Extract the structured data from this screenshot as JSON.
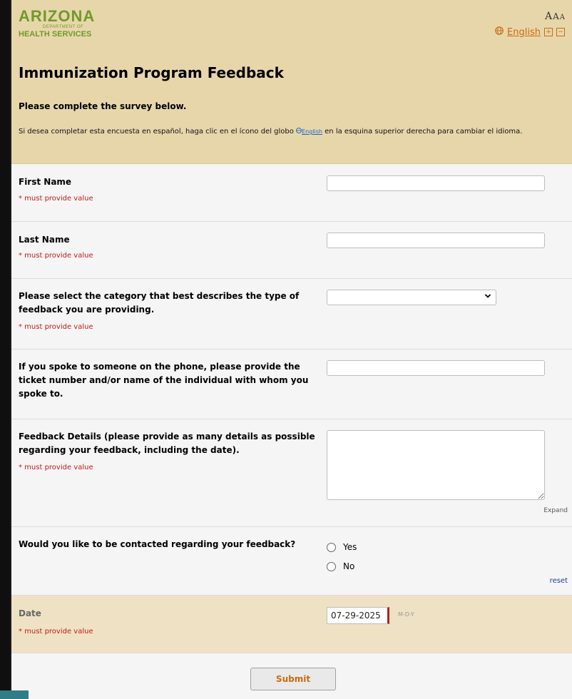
{
  "header": {
    "logo_line1": "ARIZONA",
    "logo_line2": "DEPARTMENT OF",
    "logo_line3": "HEALTH SERVICES",
    "font_size_controls": [
      "A",
      "A",
      "A"
    ],
    "language": "English",
    "plus": "+",
    "minus": "−",
    "title": "Immunization Program Feedback",
    "instructions": "Please complete the survey below.",
    "spanish_prefix": "Si desea completar esta encuesta en español, haga clic en el ícono del globo",
    "spanish_link": "English",
    "spanish_suffix": "en la esquina superior derecha para cambiar el idioma."
  },
  "form": {
    "required_text": "* must provide value",
    "first_name": {
      "label": "First Name",
      "value": ""
    },
    "last_name": {
      "label": "Last Name",
      "value": ""
    },
    "category": {
      "label": "Please select the category that best describes the type of feedback you are providing.",
      "value": ""
    },
    "ticket": {
      "label": "If you spoke to someone on the phone, please provide the ticket number and/or name of the individual with whom you spoke to.",
      "value": ""
    },
    "details": {
      "label": "Feedback Details (please provide as many details as possible regarding your feedback, including the date).",
      "value": "",
      "expand": "Expand"
    },
    "contact": {
      "label": "Would you like to be contacted regarding your feedback?",
      "options": [
        "Yes",
        "No"
      ],
      "reset": "reset"
    },
    "date": {
      "label": "Date",
      "value": "07-29-2025",
      "format": "M-D-Y"
    },
    "submit": "Submit"
  },
  "colors": {
    "header_bg": "#e8d6ab",
    "accent_orange": "#c76c12",
    "required_red": "#c21a1a",
    "logo_green": "#6f9a2a",
    "frame_teal": "#2e7d87"
  }
}
